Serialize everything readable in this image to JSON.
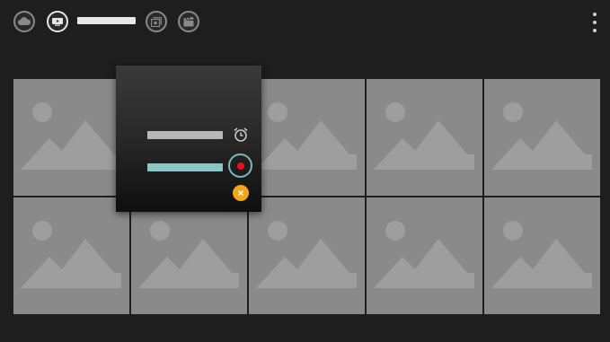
{
  "topbar": {
    "buttons": [
      {
        "icon": "cloud-icon",
        "active": false
      },
      {
        "icon": "tv-icon",
        "active": true
      },
      {
        "icon": "photo-gallery-icon",
        "active": false
      },
      {
        "icon": "clapperboard-icon",
        "active": false
      }
    ],
    "menu_icon": "more-vert-icon"
  },
  "grid": {
    "rows": 2,
    "columns": 5,
    "tile_icon": "image-placeholder-icon"
  },
  "popup": {
    "alarm_icon": "alarm-icon",
    "record_icon": "record-icon",
    "close_icon": "close-icon"
  },
  "colors": {
    "background": "#1e1e1e",
    "tile": "#8a8a8a",
    "accent_teal": "#8ec4c4",
    "record_red": "#e8121e",
    "close_orange": "#f2a51d"
  }
}
